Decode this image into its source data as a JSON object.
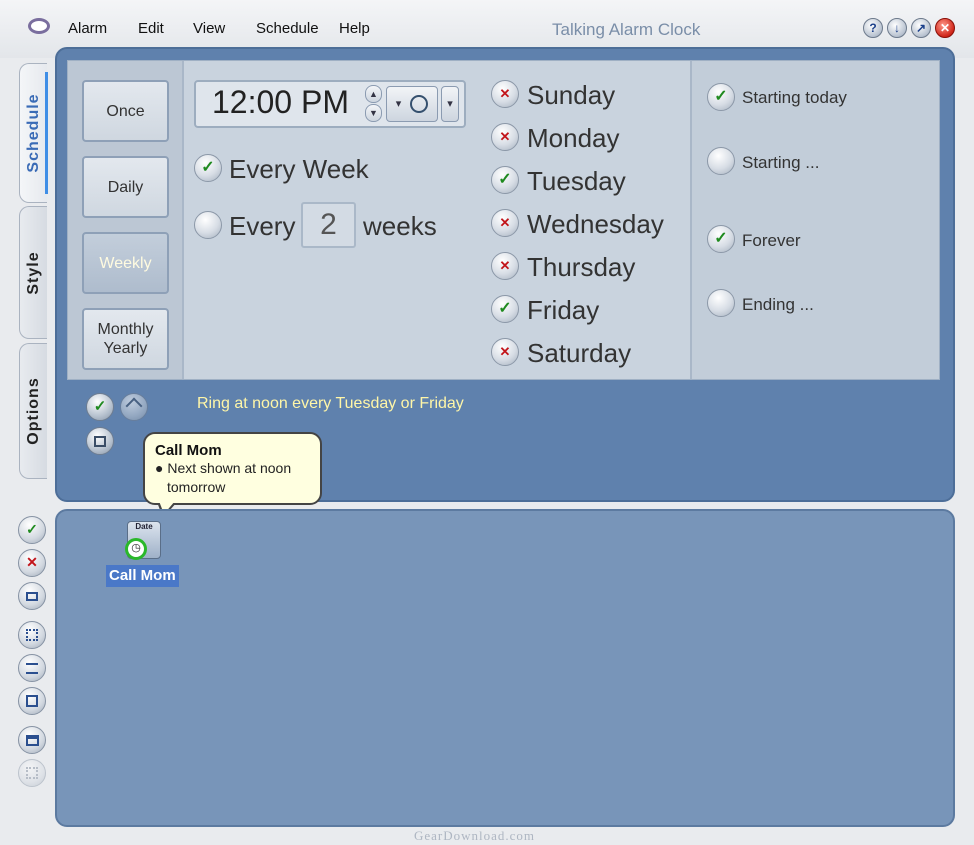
{
  "menu": {
    "items": [
      "Alarm",
      "Edit",
      "View",
      "Schedule",
      "Help"
    ]
  },
  "window": {
    "title": "Talking Alarm Clock",
    "buttons": [
      "help",
      "minimize",
      "restore",
      "close"
    ],
    "button_glyphs": {
      "help": "?",
      "minimize": "↓",
      "restore": "↗",
      "close": "✕"
    }
  },
  "tabs": {
    "schedule": "Schedule",
    "style": "Style",
    "options": "Options",
    "active": "Schedule"
  },
  "frequency": {
    "once": "Once",
    "daily": "Daily",
    "weekly": "Weekly",
    "monthly_yearly_line1": "Monthly",
    "monthly_yearly_line2": "Yearly",
    "selected": "Weekly"
  },
  "time": {
    "value": "12:00 PM",
    "up": "▲",
    "down": "▼",
    "dropdown": "▾"
  },
  "repeat": {
    "every_week": "Every Week",
    "every_week_selected": true,
    "every_prefix": "Every",
    "every_n": "2",
    "every_suffix": "weeks"
  },
  "days": [
    {
      "name": "Sunday",
      "checked": false
    },
    {
      "name": "Monday",
      "checked": false
    },
    {
      "name": "Tuesday",
      "checked": true
    },
    {
      "name": "Wednesday",
      "checked": false
    },
    {
      "name": "Thursday",
      "checked": false
    },
    {
      "name": "Friday",
      "checked": true
    },
    {
      "name": "Saturday",
      "checked": false
    }
  ],
  "range": {
    "starting_today": "Starting today",
    "starting": "Starting ...",
    "forever": "Forever",
    "ending": "Ending ...",
    "starting_today_selected": true,
    "forever_selected": true
  },
  "status": {
    "description": "Ring at noon every Tuesday or Friday"
  },
  "tooltip": {
    "title": "Call Mom",
    "line": "Next shown at noon tomorrow"
  },
  "alarm_item": {
    "label": "Call Mom",
    "icon_text": "Date"
  },
  "glyphs": {
    "check": "✓",
    "cross": "✕"
  },
  "watermark": "GearDownload.com",
  "colors": {
    "panel_blue": "#5f81ad",
    "list_blue": "#7895b9",
    "status_text": "#fff6a8",
    "check_green": "#1f8a1f",
    "cross_red": "#c2141a"
  }
}
